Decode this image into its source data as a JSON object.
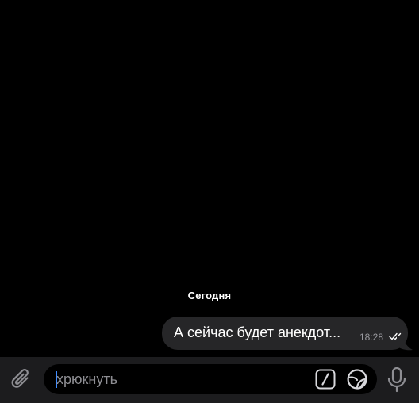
{
  "chat": {
    "date_separator": "Сегодня",
    "messages": [
      {
        "text": "А сейчас будет анекдот...",
        "time": "18:28",
        "status_icon": "double-check-icon",
        "outgoing": true
      }
    ]
  },
  "composer": {
    "placeholder": "хрюкнуть",
    "attach_icon": "paperclip-icon",
    "commands_icon": "slash-command-icon",
    "sticker_icon": "sticker-icon",
    "voice_icon": "microphone-icon"
  },
  "colors": {
    "background": "#000000",
    "bubble": "#262628",
    "input_bar": "#1c1c1e",
    "caret": "#3e8bff",
    "muted_text": "#8e8e93"
  }
}
